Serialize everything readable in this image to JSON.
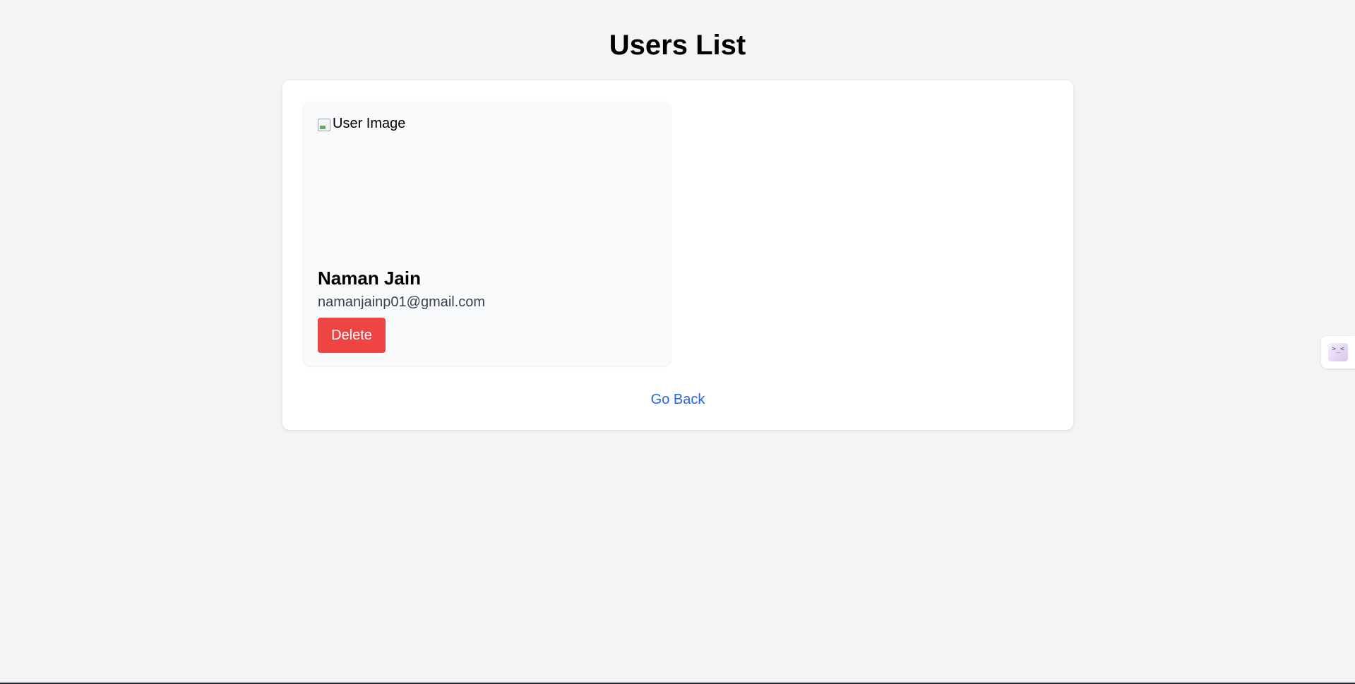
{
  "page": {
    "title": "Users List"
  },
  "users": [
    {
      "image_alt": "User Image",
      "name": "Naman Jain",
      "email": "namanjainp01@gmail.com",
      "delete_label": "Delete"
    }
  ],
  "navigation": {
    "go_back_label": "Go Back"
  },
  "side_widget": {
    "glyph": ">_<"
  },
  "colors": {
    "background": "#f3f4f6",
    "panel": "#ffffff",
    "card": "#f9fafb",
    "delete": "#ef4444",
    "link": "#2563eb"
  }
}
